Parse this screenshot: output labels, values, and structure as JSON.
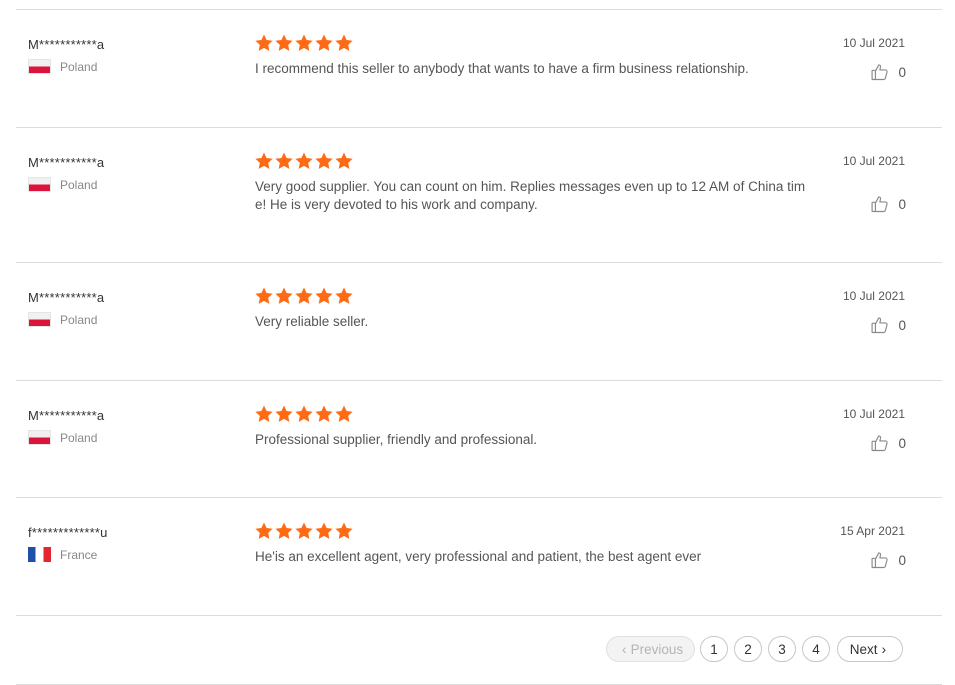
{
  "reviews": [
    {
      "user": "M***********a",
      "country": "Poland",
      "flag": "pl",
      "rating": 5,
      "date": "10 Jul 2021",
      "text": "I recommend this seller to anybody that wants to have a firm business relationship.",
      "likes": "0"
    },
    {
      "user": "M***********a",
      "country": "Poland",
      "flag": "pl",
      "rating": 5,
      "date": "10 Jul 2021",
      "text": "Very good supplier. You can count on him. Replies messages even up to 12 AM of China time! He is very devoted to his work and company.",
      "likes": "0"
    },
    {
      "user": "M***********a",
      "country": "Poland",
      "flag": "pl",
      "rating": 5,
      "date": "10 Jul 2021",
      "text": "Very reliable seller.",
      "likes": "0"
    },
    {
      "user": "M***********a",
      "country": "Poland",
      "flag": "pl",
      "rating": 5,
      "date": "10 Jul 2021",
      "text": "Professional supplier, friendly and professional.",
      "likes": "0"
    },
    {
      "user": "f*************u",
      "country": "France",
      "flag": "fr",
      "rating": 5,
      "date": "15 Apr 2021",
      "text": "He'is an excellent agent, very professional and patient, the best agent ever",
      "likes": "0"
    }
  ],
  "pagination": {
    "previous_label": "Previous",
    "next_label": "Next",
    "pages": [
      "1",
      "2",
      "3",
      "4"
    ]
  },
  "colors": {
    "star": "#ff6a14",
    "divider": "#dcdcdc"
  },
  "icons": {
    "like": "thumbs-up-icon",
    "star": "star-icon",
    "prev": "chevron-left-icon",
    "next": "chevron-right-icon"
  }
}
